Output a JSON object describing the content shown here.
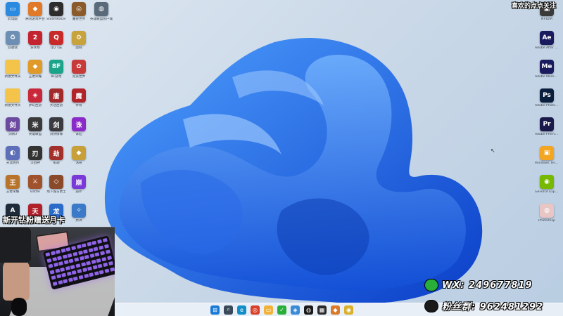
{
  "overlay": {
    "top_right": "喜欢的点点关注",
    "promo": "新开钻粉赠送月卡",
    "wechat": "WX: 249677819",
    "qq_group": "粉丝群: 962481292"
  },
  "desktop": {
    "col1": [
      {
        "label": "此电脑",
        "icon": "monitor-icon",
        "color": "#2a8ae0",
        "glyph": "▭"
      },
      {
        "label": "回收站",
        "icon": "recycle-bin-icon",
        "color": "#6d8fb3",
        "glyph": "♻"
      },
      {
        "label": "新建文件夹",
        "icon": "folder-icon",
        "color": "#f4c34a",
        "glyph": ""
      },
      {
        "label": "新建文件夹",
        "icon": "folder-icon",
        "color": "#f4c34a",
        "glyph": ""
      },
      {
        "label": "剑网3",
        "icon": "game-icon",
        "color": "#6b4aa0",
        "glyph": "剑"
      },
      {
        "label": "天涯明月",
        "icon": "game-icon",
        "color": "#5c6fb8",
        "glyph": "◐"
      },
      {
        "label": "王者荣耀",
        "icon": "game-icon",
        "color": "#b8742a",
        "glyph": "王"
      },
      {
        "label": "Aion",
        "icon": "game-icon",
        "color": "#1f2b3a",
        "glyph": "A"
      }
    ],
    "col2": [
      {
        "label": "腾讯游戏平台",
        "icon": "game-icon",
        "color": "#e07a2a",
        "glyph": "◆"
      },
      {
        "label": "逆水寒",
        "icon": "game-icon",
        "color": "#c3242f",
        "glyph": "2"
      },
      {
        "label": "王者荣耀",
        "icon": "game-icon",
        "color": "#e09a2a",
        "glyph": "◆"
      },
      {
        "label": "梦幻西游",
        "icon": "game-icon",
        "color": "#c8283a",
        "glyph": "◈"
      },
      {
        "label": "英雄联盟",
        "icon": "game-icon",
        "color": "#3a3a3a",
        "glyph": "米"
      },
      {
        "label": "斗战神",
        "icon": "game-icon",
        "color": "#333333",
        "glyph": "刃"
      },
      {
        "label": "Battle",
        "icon": "game-icon",
        "color": "#a0522d",
        "glyph": "⚔"
      },
      {
        "label": "天涯",
        "icon": "game-icon",
        "color": "#b0202a",
        "glyph": "天"
      }
    ],
    "col3": [
      {
        "label": "SteamRacer",
        "icon": "game-icon",
        "color": "#2d2d2d",
        "glyph": "◉"
      },
      {
        "label": "QQ飞车",
        "icon": "game-icon",
        "color": "#c82a2a",
        "glyph": "Q"
      },
      {
        "label": "8F游戏",
        "icon": "game-icon",
        "color": "#1aa58a",
        "glyph": "8F"
      },
      {
        "label": "大话西游",
        "icon": "game-icon",
        "color": "#a32a2a",
        "glyph": "唐"
      },
      {
        "label": "剑侠情缘",
        "icon": "game-icon",
        "color": "#3a3a40",
        "glyph": "剑"
      },
      {
        "label": "永劫",
        "icon": "game-icon",
        "color": "#a3302a",
        "glyph": "劫"
      },
      {
        "label": "地下城与勇士",
        "icon": "game-icon",
        "color": "#8a4a2a",
        "glyph": "◇"
      },
      {
        "label": "天龙",
        "icon": "game-icon",
        "color": "#2a6ac8",
        "glyph": "龙"
      }
    ],
    "col4": [
      {
        "label": "魔兽世界",
        "icon": "game-icon",
        "color": "#8a5a2a",
        "glyph": "◎"
      },
      {
        "label": "战网",
        "icon": "game-icon",
        "color": "#c8a23a",
        "glyph": "⚙"
      },
      {
        "label": "完美世界",
        "icon": "game-icon",
        "color": "#c83a3a",
        "glyph": "✿"
      },
      {
        "label": "传奇",
        "icon": "game-icon",
        "color": "#b0242a",
        "glyph": "魔"
      },
      {
        "label": "诛仙",
        "icon": "game-icon",
        "color": "#8a2ac8",
        "glyph": "诛"
      },
      {
        "label": "洛奇",
        "icon": "game-icon",
        "color": "#c8a03a",
        "glyph": "◆"
      },
      {
        "label": "崩坏",
        "icon": "game-icon",
        "color": "#7a3ad8",
        "glyph": "崩"
      },
      {
        "label": "原神",
        "icon": "game-icon",
        "color": "#3a7ac8",
        "glyph": "✧"
      }
    ],
    "col5": [
      {
        "label": "英雄联盟客户端",
        "icon": "game-icon",
        "color": "#5a6a7a",
        "glyph": "◍"
      }
    ],
    "right": [
      {
        "label": "NVIDIA",
        "icon": "app-icon",
        "color": "#3a3a3a",
        "glyph": "▣"
      },
      {
        "label": "Adobe After Effects",
        "icon": "after-effects-icon",
        "color": "#1a1a5e",
        "glyph": "Ae"
      },
      {
        "label": "Adobe Media Encoder",
        "icon": "media-encoder-icon",
        "color": "#1a1a5e",
        "glyph": "Me"
      },
      {
        "label": "Adobe Photoshop",
        "icon": "photoshop-icon",
        "color": "#0a1f3d",
        "glyph": "Ps"
      },
      {
        "label": "Adobe Premiere",
        "icon": "premiere-icon",
        "color": "#1a1a4a",
        "glyph": "Pr"
      },
      {
        "label": "Windows Terminal",
        "icon": "terminal-icon",
        "color": "#f2a623",
        "glyph": "▣"
      },
      {
        "label": "GeForce Experience",
        "icon": "nvidia-icon",
        "color": "#76b900",
        "glyph": "◉"
      },
      {
        "label": "Photoshop",
        "icon": "app-icon",
        "color": "#e8c6c6",
        "glyph": "◍"
      }
    ]
  },
  "taskbar": [
    {
      "name": "start-button",
      "color": "#1a7ad8",
      "glyph": "⊞"
    },
    {
      "name": "search-icon",
      "color": "#3a4a5a",
      "glyph": "⌕"
    },
    {
      "name": "edge-icon",
      "color": "#0f8ec8",
      "glyph": "e"
    },
    {
      "name": "chrome-icon",
      "color": "#d8402a",
      "glyph": "◎"
    },
    {
      "name": "file-explorer-icon",
      "color": "#f2b23a",
      "glyph": "▭"
    },
    {
      "name": "wechat-icon",
      "color": "#2aae3a",
      "glyph": "✓"
    },
    {
      "name": "app-icon",
      "color": "#3a8ad8",
      "glyph": "◈"
    },
    {
      "name": "qq-icon",
      "color": "#1a1a1a",
      "glyph": "◍"
    },
    {
      "name": "app-icon",
      "color": "#2a2a2a",
      "glyph": "▦"
    },
    {
      "name": "app-icon",
      "color": "#d87a2a",
      "glyph": "◆"
    },
    {
      "name": "app-icon",
      "color": "#d8b02a",
      "glyph": "◉"
    }
  ]
}
